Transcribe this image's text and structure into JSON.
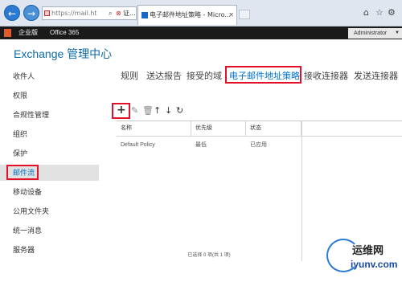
{
  "browser": {
    "address_text": "https://mail.ht",
    "tab_title": "电子邮件地址策略 - Micro...",
    "cert_error_label": "证...",
    "back_icon": "arrow-left-icon",
    "forward_icon": "arrow-right-icon",
    "home_icon": "home-icon",
    "star_icon": "star-icon",
    "gear_icon": "gear-icon"
  },
  "o365": {
    "edition": "企业版",
    "product": "Office 365",
    "user": "Administrator"
  },
  "app": {
    "title": "Exchange 管理中心"
  },
  "sidebar": {
    "items": [
      {
        "label": "收件人"
      },
      {
        "label": "权限"
      },
      {
        "label": "合规性管理"
      },
      {
        "label": "组织"
      },
      {
        "label": "保护"
      },
      {
        "label": "邮件流"
      },
      {
        "label": "移动设备"
      },
      {
        "label": "公用文件夹"
      },
      {
        "label": "统一消息"
      },
      {
        "label": "服务器"
      }
    ],
    "active_index": 5
  },
  "tabs": [
    {
      "label": "规则"
    },
    {
      "label": "送达报告"
    },
    {
      "label": "接受的域"
    },
    {
      "label": "电子邮件地址策略"
    },
    {
      "label": "接收连接器"
    },
    {
      "label": "发送连接器"
    }
  ],
  "active_tab_index": 3,
  "toolbar": {
    "add": "+",
    "edit": "✎",
    "delete": "🗑",
    "up": "↑",
    "down": "↓",
    "refresh": "↻"
  },
  "table": {
    "columns": [
      "名称",
      "优先级",
      "状态"
    ],
    "rows": [
      {
        "name": "Default Policy",
        "priority": "最低",
        "status": "已应用"
      }
    ],
    "status_text": "已选择 0 项(共 1 项)"
  },
  "watermark": {
    "brand": "运维网",
    "domain": "iyunv.com"
  },
  "colors": {
    "accent": "#0072c6",
    "highlight": "#e3102a",
    "topbar": "#1a1a1a"
  }
}
